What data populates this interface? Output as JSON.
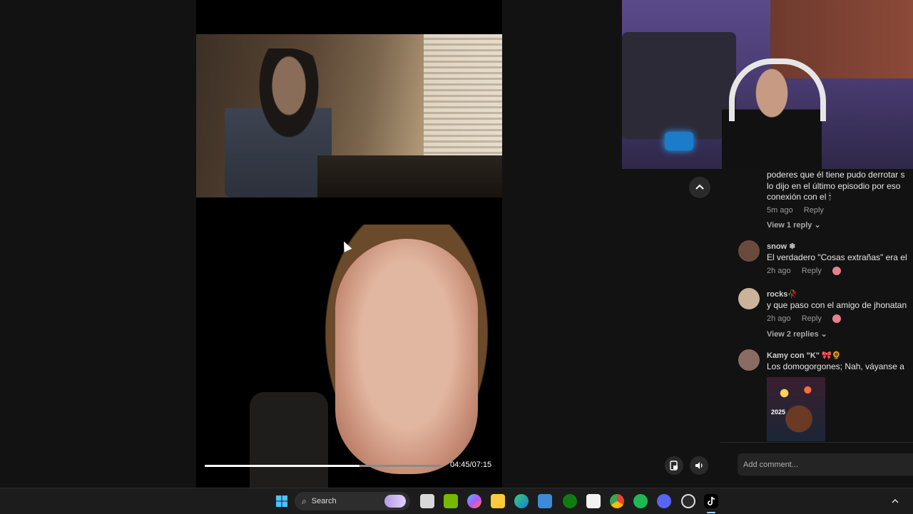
{
  "player": {
    "progress_fraction": 0.655,
    "time": "04:45/07:15"
  },
  "controls": {
    "expand_icon": "chevron-up-icon",
    "pip_icon": "picture-in-picture-icon",
    "volume_icon": "volume-icon"
  },
  "comments": {
    "top_partial": {
      "lines": [
        "poderes que él tiene pudo derrotar s",
        "lo dijo en el último episodio por eso",
        "conexión con el 🕯"
      ],
      "time": "5m ago",
      "reply": "Reply",
      "view_replies": "View 1 reply"
    },
    "items": [
      {
        "name": "snow ❄",
        "text": "El verdadero \"Cosas extrañas\" era el",
        "time": "2h ago",
        "reply": "Reply",
        "avatar_color": "#6b4a3e"
      },
      {
        "name": "rocks🥀",
        "text": "y que paso con el amigo de jhonatan",
        "time": "2h ago",
        "reply": "Reply",
        "view_replies": "View 2 replies",
        "avatar_color": "#c9b49a"
      },
      {
        "name": "Kamy con \"K\" 🎀🌻",
        "text": "Los domogorgones; Nah, váyanse a",
        "avatar_color": "#8a6c62",
        "sticker_text": "2025"
      }
    ],
    "add_placeholder": "Add comment..."
  },
  "taskbar": {
    "search_label": "Search",
    "icons": [
      "windows-start-icon",
      "task-view-icon",
      "nvidia-icon",
      "copilot-icon",
      "file-explorer-icon",
      "edge-icon",
      "store-icon",
      "xbox-icon",
      "notepad-icon",
      "chrome-icon",
      "spotify-icon",
      "discord-icon",
      "obs-icon",
      "tiktok-icon"
    ],
    "tray_icon": "chevron-up-icon"
  }
}
